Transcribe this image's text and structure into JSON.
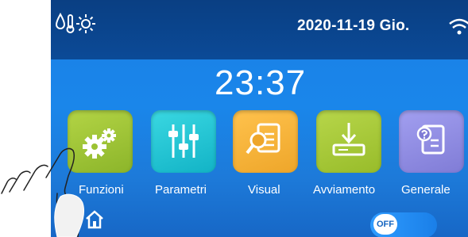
{
  "header": {
    "date": "2020-11-19 Gio.",
    "icons": [
      "water-drop-icon",
      "thermometer-icon",
      "sun-icon",
      "wifi-icon"
    ]
  },
  "clock": {
    "time": "23:37"
  },
  "menu": {
    "items": [
      {
        "label": "Funzioni",
        "icon": "gears-icon",
        "color": "#9cc332"
      },
      {
        "label": "Parametri",
        "icon": "sliders-icon",
        "color": "#19c6d4"
      },
      {
        "label": "Visual",
        "icon": "document-search-icon",
        "color": "#f4b33a"
      },
      {
        "label": "Avviamento",
        "icon": "download-icon",
        "color": "#a6c932"
      },
      {
        "label": "Generale",
        "icon": "document-question-icon",
        "color": "#8e8be0"
      }
    ]
  },
  "footer": {
    "home_icon": "home-icon",
    "toggle": {
      "state": "OFF"
    }
  },
  "overlay": {
    "icon": "hand-pointer-icon"
  }
}
